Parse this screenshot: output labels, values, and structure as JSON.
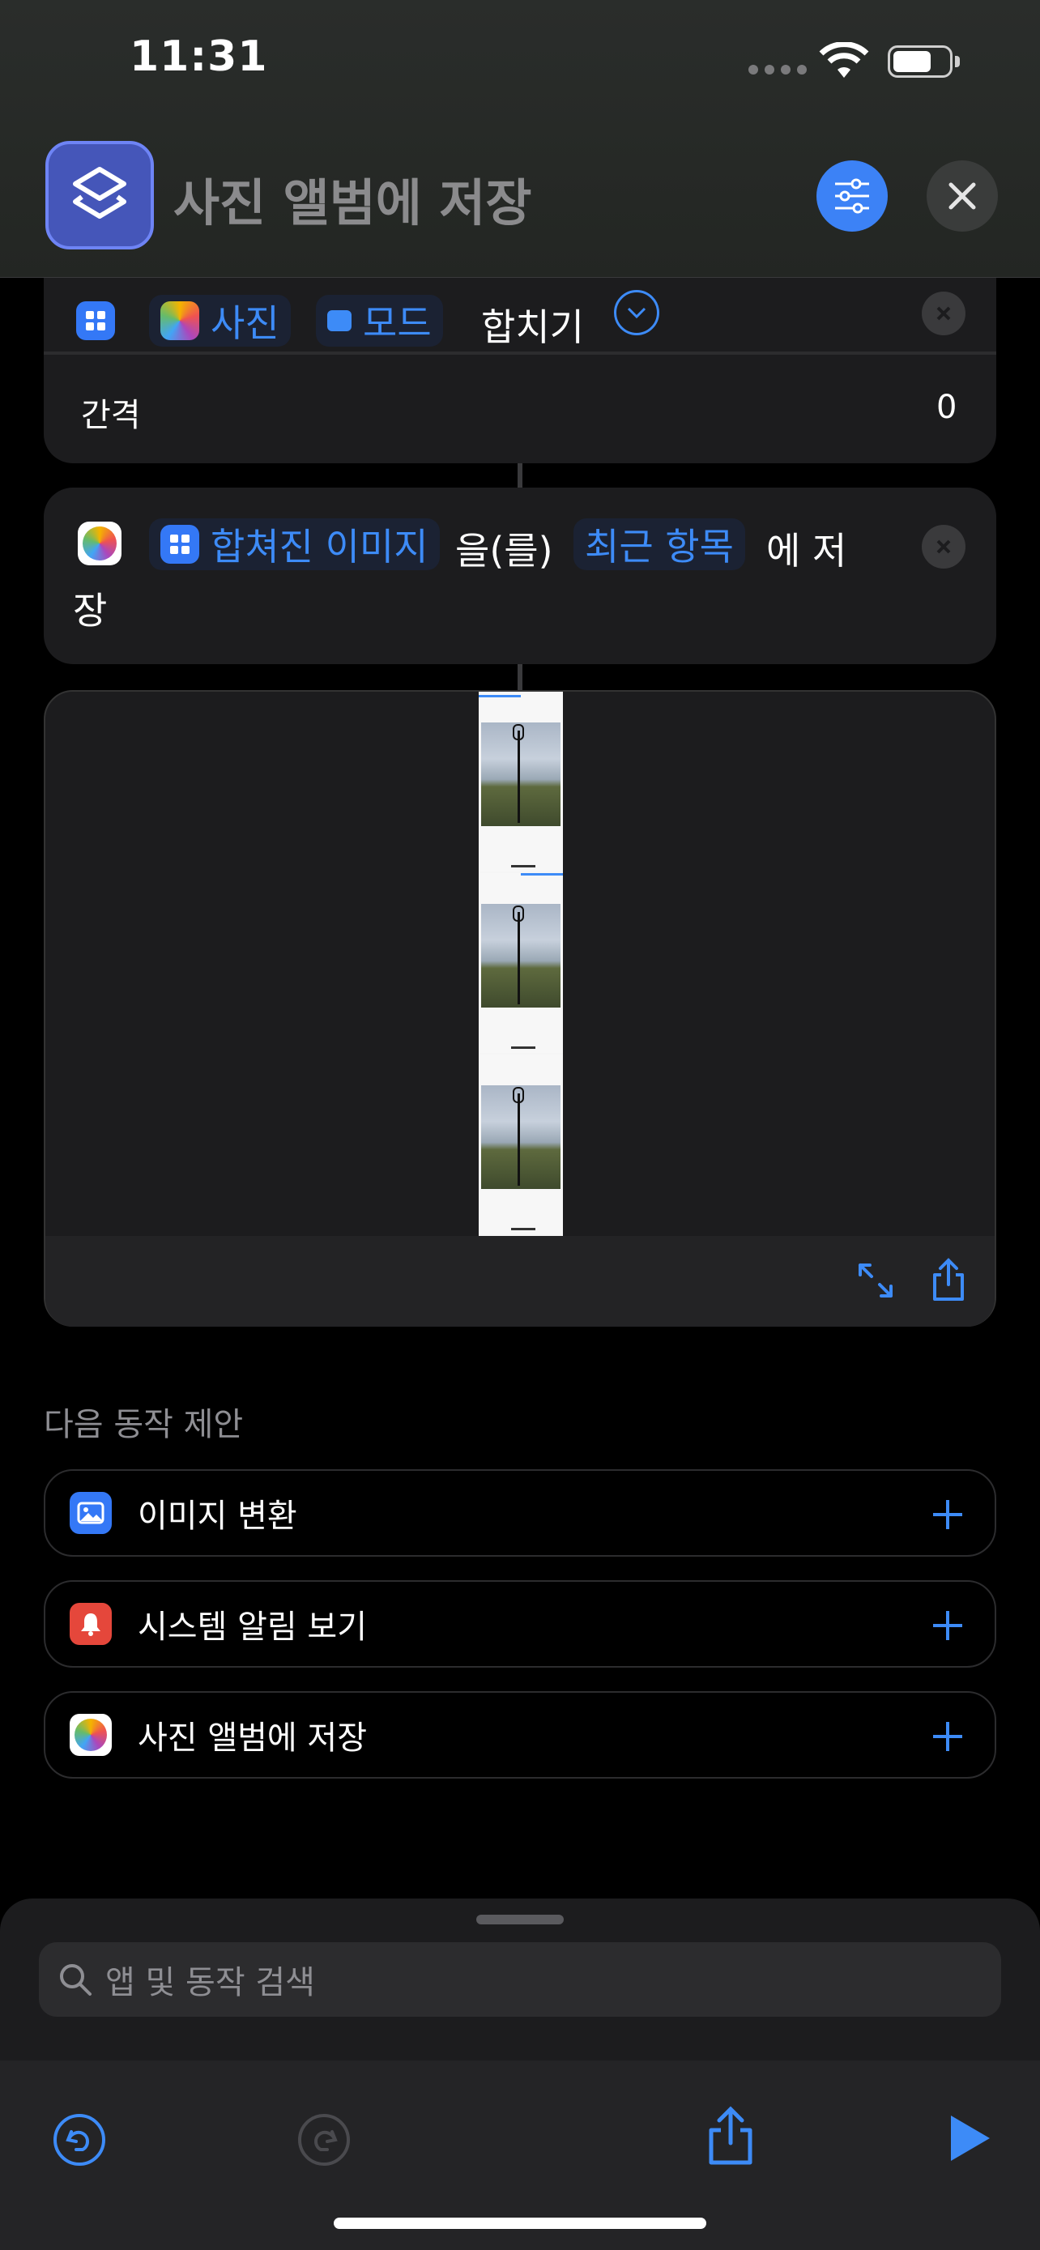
{
  "status_bar": {
    "time": "11:31"
  },
  "header": {
    "title": "사진 앨범에 저장"
  },
  "combine_action": {
    "token_photos": "사진",
    "token_mode": "모드",
    "text_combine": "합치기",
    "spacing_label": "간격",
    "spacing_value": "0"
  },
  "save_action": {
    "token_image": "합쳐진 이미지",
    "text_object": "을(를)",
    "token_album": "최근 항목",
    "text_save_a": "에 저",
    "text_save_b": "장"
  },
  "suggestions": {
    "heading": "다음 동작 제안",
    "items": [
      {
        "label": "이미지 변환",
        "icon": "image-icon",
        "color": "#3478f6"
      },
      {
        "label": "시스템 알림 보기",
        "icon": "bell-icon",
        "color": "#e5473b"
      },
      {
        "label": "사진 앨범에 저장",
        "icon": "photos-icon",
        "color": "#ffffff"
      }
    ]
  },
  "search": {
    "placeholder": "앱 및 동작 검색"
  },
  "colors": {
    "accent": "#3d8bf7",
    "background": "#000000",
    "card": "#1c1c1e"
  }
}
